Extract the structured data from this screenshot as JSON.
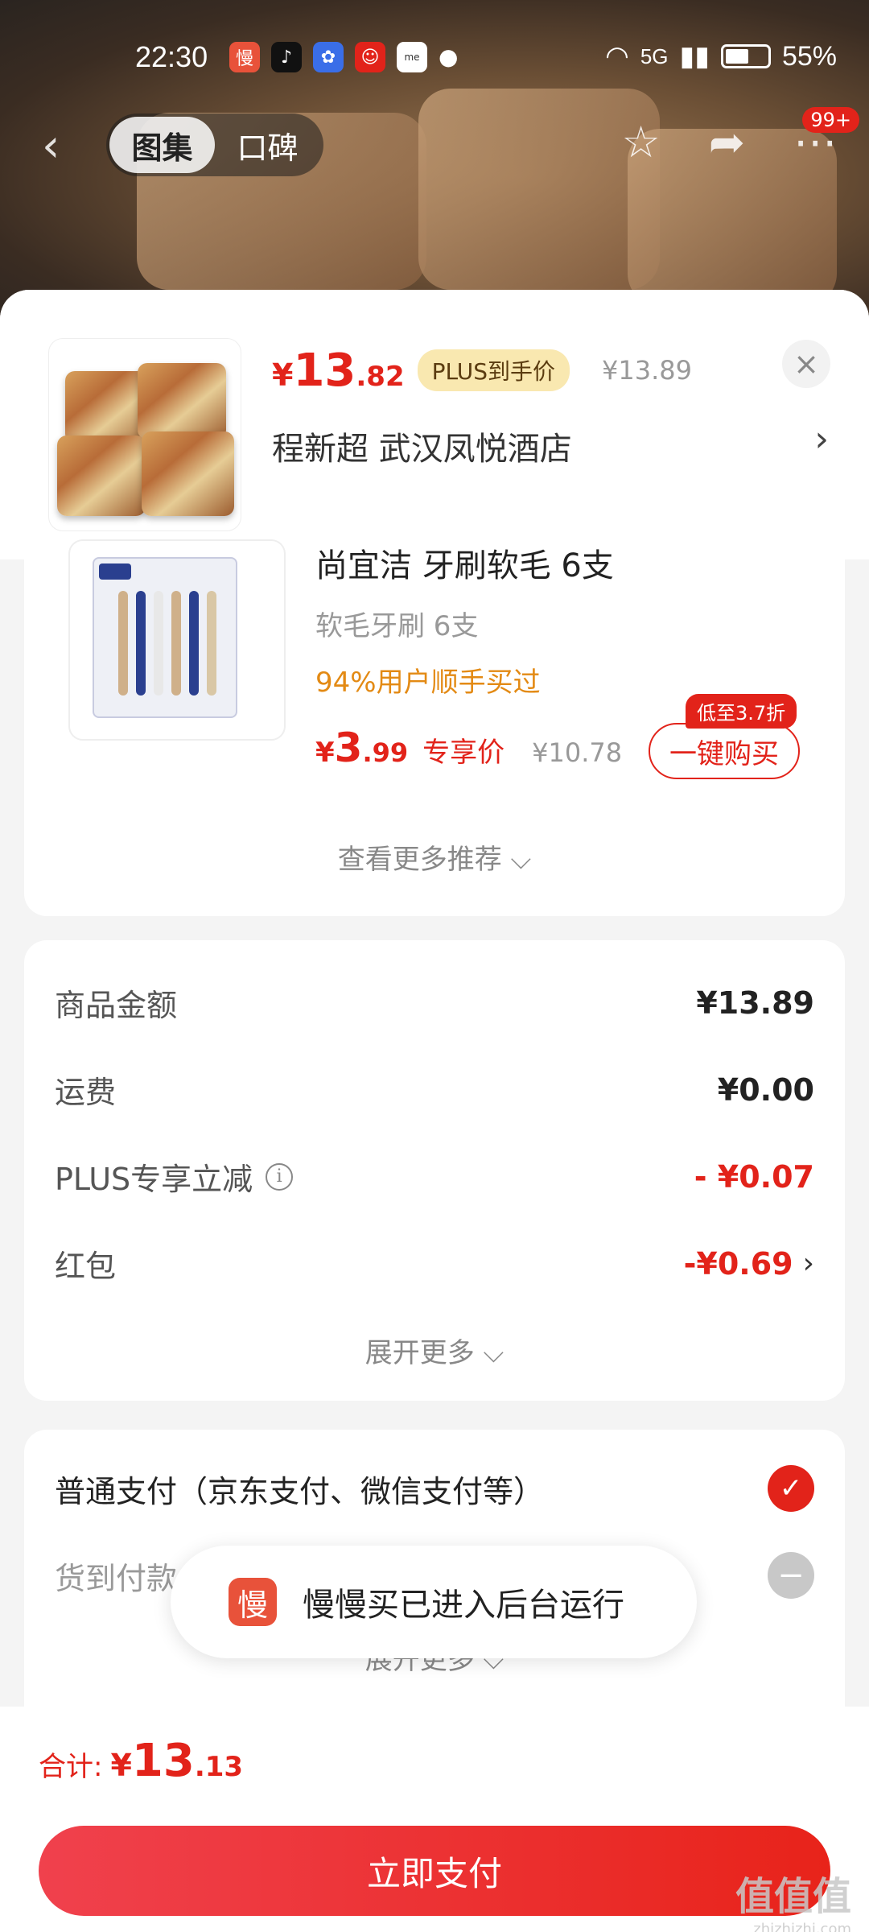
{
  "status": {
    "time": "22:30",
    "battery": "55%",
    "network": "5G"
  },
  "nav": {
    "tab_gallery": "图集",
    "tab_reviews": "口碑",
    "badge": "99+"
  },
  "header": {
    "price_yen": "¥",
    "price_int": "13",
    "price_dec": ".82",
    "plus_tag": "PLUS到手价",
    "orig_price": "¥13.89",
    "address": "程新超  武汉凤悦酒店"
  },
  "recommend": {
    "title": "尚宜洁 牙刷软毛 6支",
    "subtitle": "软毛牙刷 6支",
    "stat": "94%用户顺手买过",
    "price_yen": "¥",
    "price_int": "3",
    "price_dec": ".99",
    "exclusive": "专享价",
    "orig_price": "¥10.78",
    "discount_badge": "低至3.7折",
    "buy_label": "一键购买",
    "more_label": "查看更多推荐 ⌵"
  },
  "summary": {
    "rows": [
      {
        "label": "商品金额",
        "value": "¥13.89"
      },
      {
        "label": "运费",
        "value": "¥0.00"
      },
      {
        "label": "PLUS专享立减",
        "value": "- ¥0.07"
      },
      {
        "label": "红包",
        "value": "-¥0.69"
      }
    ],
    "expand_label": "展开更多 ⌵"
  },
  "payment": {
    "normal": "普通支付（京东支付、微信支付等）",
    "cod": "货到付款  商品属性或所在地区不支持货到付款",
    "expand_label": "展开更多 ⌵"
  },
  "toast": {
    "text": "慢慢买已进入后台运行",
    "icon_char": "慢"
  },
  "bottom": {
    "total_label": "合计:",
    "total_yen": "¥",
    "total_int": "13",
    "total_dec": ".13",
    "pay_button": "立即支付"
  },
  "watermark": {
    "main": "值值值",
    "sub": "zhizhizhi.com"
  },
  "colors": {
    "accent": "#e2231a",
    "plus_tag_bg": "#f9e8b0",
    "sale_orange": "#e38a14"
  }
}
